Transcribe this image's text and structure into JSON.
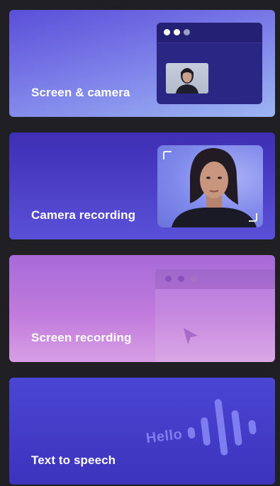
{
  "cards": [
    {
      "id": "screen-camera",
      "label": "Screen & camera"
    },
    {
      "id": "camera-recording",
      "label": "Camera recording"
    },
    {
      "id": "screen-recording",
      "label": "Screen recording"
    },
    {
      "id": "text-to-speech",
      "label": "Text to speech",
      "illustration_text": "Hello"
    }
  ],
  "colors": {
    "background": "#1f1f24",
    "card1": "#6a67e0",
    "card2": "#4a3fc8",
    "card3": "#c07bdc",
    "card4": "#4440cc"
  },
  "icons": {
    "card1": "screen-with-camera-thumbnail-icon",
    "card2": "camera-viewfinder-icon",
    "card3": "browser-window-cursor-icon",
    "card4": "sound-wave-icon"
  }
}
